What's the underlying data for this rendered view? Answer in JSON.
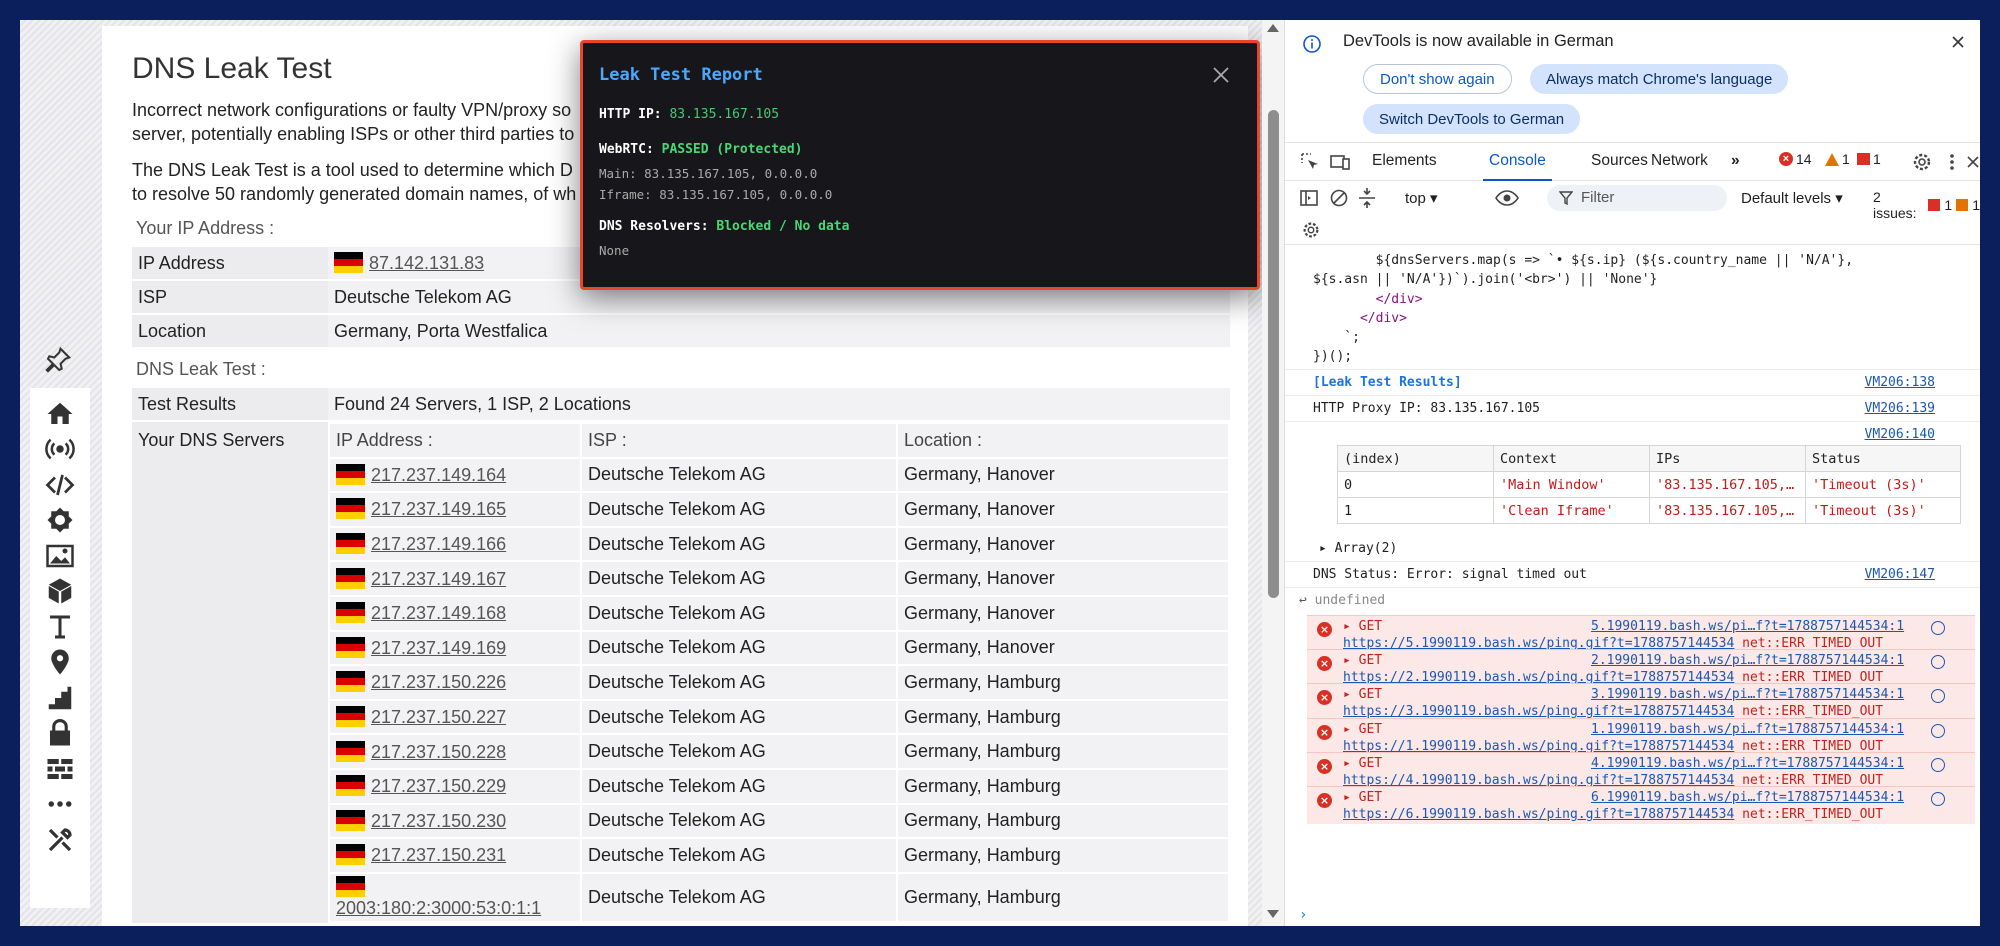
{
  "page": {
    "title": "DNS Leak Test",
    "intro_p1_line1": "Incorrect network configurations or faulty VPN/proxy so",
    "intro_p1_line2": "server, potentially enabling ISPs or other third parties to",
    "intro_p2_line1": "The DNS Leak Test is a tool used to determine which D",
    "intro_p2_line2": "to resolve 50 randomly generated domain names, of wh",
    "your_ip_heading": "Your IP Address :",
    "ip_rows": [
      {
        "key": "IP Address",
        "value": "87.142.131.83"
      },
      {
        "key": "ISP",
        "value": "Deutsche Telekom AG"
      },
      {
        "key": "Location",
        "value": "Germany, Porta Westfalica"
      }
    ],
    "dns_heading": "DNS Leak Test :",
    "test_results_key": "Test Results",
    "test_results_value": "Found 24 Servers, 1 ISP, 2 Locations",
    "dns_servers_key": "Your DNS Servers",
    "dns_columns": [
      "IP Address :",
      "ISP :",
      "Location :"
    ],
    "dns_rows": [
      {
        "ip": "217.237.149.164",
        "isp": "Deutsche Telekom AG",
        "loc": "Germany, Hanover"
      },
      {
        "ip": "217.237.149.165",
        "isp": "Deutsche Telekom AG",
        "loc": "Germany, Hanover"
      },
      {
        "ip": "217.237.149.166",
        "isp": "Deutsche Telekom AG",
        "loc": "Germany, Hanover"
      },
      {
        "ip": "217.237.149.167",
        "isp": "Deutsche Telekom AG",
        "loc": "Germany, Hanover"
      },
      {
        "ip": "217.237.149.168",
        "isp": "Deutsche Telekom AG",
        "loc": "Germany, Hanover"
      },
      {
        "ip": "217.237.149.169",
        "isp": "Deutsche Telekom AG",
        "loc": "Germany, Hanover"
      },
      {
        "ip": "217.237.150.226",
        "isp": "Deutsche Telekom AG",
        "loc": "Germany, Hamburg"
      },
      {
        "ip": "217.237.150.227",
        "isp": "Deutsche Telekom AG",
        "loc": "Germany, Hamburg"
      },
      {
        "ip": "217.237.150.228",
        "isp": "Deutsche Telekom AG",
        "loc": "Germany, Hamburg"
      },
      {
        "ip": "217.237.150.229",
        "isp": "Deutsche Telekom AG",
        "loc": "Germany, Hamburg"
      },
      {
        "ip": "217.237.150.230",
        "isp": "Deutsche Telekom AG",
        "loc": "Germany, Hamburg"
      },
      {
        "ip": "217.237.150.231",
        "isp": "Deutsche Telekom AG",
        "loc": "Germany, Hamburg"
      },
      {
        "ip": "2003:180:2:3000:53:0:1:1",
        "isp": "Deutsche Telekom AG",
        "loc": "Germany, Hamburg"
      }
    ]
  },
  "modal": {
    "title": "Leak Test Report",
    "http_label": "HTTP IP:",
    "http_value": "83.135.167.105",
    "webrtc_label": "WebRTC:",
    "webrtc_value": "PASSED (Protected)",
    "main_line": "Main: 83.135.167.105, 0.0.0.0",
    "iframe_line": "Iframe: 83.135.167.105, 0.0.0.0",
    "dns_label": "DNS Resolvers:",
    "dns_value": "Blocked / No data",
    "none_line": "None"
  },
  "devtools": {
    "banner_msg": "DevTools is now available in German",
    "btn_dont_show": "Don't show again",
    "btn_match": "Always match Chrome's language",
    "btn_switch": "Switch DevTools to German",
    "tabs": [
      "Elements",
      "Console",
      "Sources",
      "Network"
    ],
    "errors_count": "14",
    "warnings_count": "1",
    "issues_count": "1",
    "context": "top",
    "filter_placeholder": "Filter",
    "levels": "Default levels",
    "issues_label": "2 issues:",
    "issues_err": "1",
    "issues_warn": "1",
    "code_line1": "        ${dnsServers.map(s => `• ${s.ip} (${s.country_name || 'N/A'},",
    "code_line2": "${s.asn || 'N/A'})`).join('<br>') || 'None'}",
    "code_line3": "        </div>",
    "code_line4": "      </div>",
    "code_line5": "    `;",
    "code_line6": "})();",
    "log1_text": "[Leak Test Results]",
    "log1_src": "VM206:138",
    "log2_text": "HTTP Proxy IP: 83.135.167.105",
    "log2_src": "VM206:139",
    "log3_src": "VM206:140",
    "table_headers": [
      "(index)",
      "Context",
      "IPs",
      "Status"
    ],
    "table_rows": [
      {
        "index": "0",
        "context": "'Main Window'",
        "ips": "'83.135.167.105,…",
        "status": "'Timeout (3s)'"
      },
      {
        "index": "1",
        "context": "'Clean Iframe'",
        "ips": "'83.135.167.105,…",
        "status": "'Timeout (3s)'"
      }
    ],
    "array_line": "Array(2)",
    "dns_status_text": "DNS Status: Error: signal timed out",
    "dns_status_src": "VM206:147",
    "undefined_text": "undefined",
    "errors": [
      {
        "src": "5.1990119.bash.ws/pi…f?t=1788757144534:1",
        "url": "https://5.1990119.bash.ws/ping.gif?t=1788757144534",
        "msg": "net::ERR_TIMED_OUT"
      },
      {
        "src": "2.1990119.bash.ws/pi…f?t=1788757144534:1",
        "url": "https://2.1990119.bash.ws/ping.gif?t=1788757144534",
        "msg": "net::ERR_TIMED_OUT"
      },
      {
        "src": "3.1990119.bash.ws/pi…f?t=1788757144534:1",
        "url": "https://3.1990119.bash.ws/ping.gif?t=1788757144534",
        "msg": "net::ERR_TIMED_OUT"
      },
      {
        "src": "1.1990119.bash.ws/pi…f?t=1788757144534:1",
        "url": "https://1.1990119.bash.ws/ping.gif?t=1788757144534",
        "msg": "net::ERR_TIMED_OUT"
      },
      {
        "src": "4.1990119.bash.ws/pi…f?t=1788757144534:1",
        "url": "https://4.1990119.bash.ws/ping.gif?t=1788757144534",
        "msg": "net::ERR_TIMED_OUT"
      },
      {
        "src": "6.1990119.bash.ws/pi…f?t=1788757144534:1",
        "url": "https://6.1990119.bash.ws/ping.gif?t=1788757144534",
        "msg": "net::ERR_TIMED_OUT"
      }
    ],
    "get_label": "GET"
  }
}
